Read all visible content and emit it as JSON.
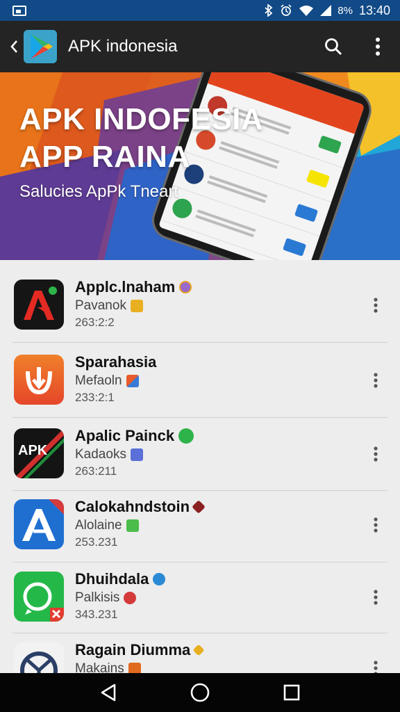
{
  "status_bar": {
    "battery_text": "8%",
    "time": "13:40",
    "icons": [
      "notification-icon",
      "bluetooth-icon",
      "alarm-icon",
      "wifi-icon",
      "signal-icon"
    ]
  },
  "app_bar": {
    "title": "APK indonesia",
    "icons": [
      "back-icon",
      "play-logo-icon",
      "search-icon",
      "overflow-menu-icon"
    ]
  },
  "banner": {
    "title_line1": "APK INDOFESIA",
    "title_line2": "APP RAINA",
    "subtitle": "Salucies ApPk Tneart"
  },
  "apps": [
    {
      "name": "Applc.lnaham",
      "publisher": "Pavanok",
      "meta": "263:2:2",
      "icon": "red-arrow-app-icon",
      "badge_color": "#9a6acb",
      "pub_badge_color": "#e8b020"
    },
    {
      "name": "Sparahasia",
      "publisher": "Mefaoln",
      "meta": "233:2:1",
      "icon": "orange-download-app-icon",
      "badge_color": "",
      "pub_badge_color": "#3a7ad4"
    },
    {
      "name": "Apalic Painck",
      "publisher": "Kadaoks",
      "meta": "263:211",
      "icon": "apk-black-app-icon",
      "badge_color": "#2db34a",
      "pub_badge_color": "#5a6fd8"
    },
    {
      "name": "Calokahndstoin",
      "publisher": "Alolaine",
      "meta": "253.231",
      "icon": "blue-a-app-icon",
      "badge_color": "#8a2020",
      "pub_badge_color": "#4bbd4b"
    },
    {
      "name": "Dhuihdala",
      "publisher": "Palkisis",
      "meta": "343.231",
      "icon": "green-phone-app-icon",
      "badge_color": "#2a8ad4",
      "pub_badge_color": "#d43a3a"
    },
    {
      "name": "Ragain Diumma",
      "publisher": "Makains",
      "meta": "",
      "icon": "steering-wheel-app-icon",
      "badge_color": "#e8b020",
      "pub_badge_color": "#e06a20"
    }
  ],
  "nav_bar": {
    "icons": [
      "back-triangle-icon",
      "home-circle-icon",
      "recents-square-icon"
    ]
  }
}
